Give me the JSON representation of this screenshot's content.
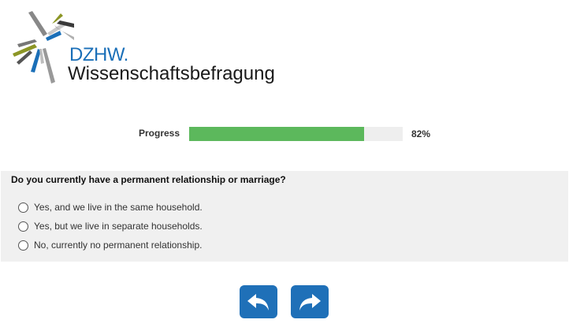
{
  "logo": {
    "brand": "DZHW.",
    "subtitle": "Wissenschaftsbefragung",
    "icon": "dzhw-starburst-logo"
  },
  "progress": {
    "label": "Progress",
    "value_percent": 82,
    "display": "82%",
    "fill_color": "#5cb85c",
    "track_color": "#eeeeee"
  },
  "question": {
    "text": "Do you currently have a permanent relationship or marriage?",
    "options": [
      {
        "label": "Yes, and we live in the same household.",
        "selected": false
      },
      {
        "label": "Yes, but we live in separate households.",
        "selected": false
      },
      {
        "label": "No, currently no permanent relationship.",
        "selected": false
      }
    ]
  },
  "navigation": {
    "back_icon": "back-arrow-icon",
    "next_icon": "forward-arrow-icon",
    "button_color": "#1f70b8"
  }
}
